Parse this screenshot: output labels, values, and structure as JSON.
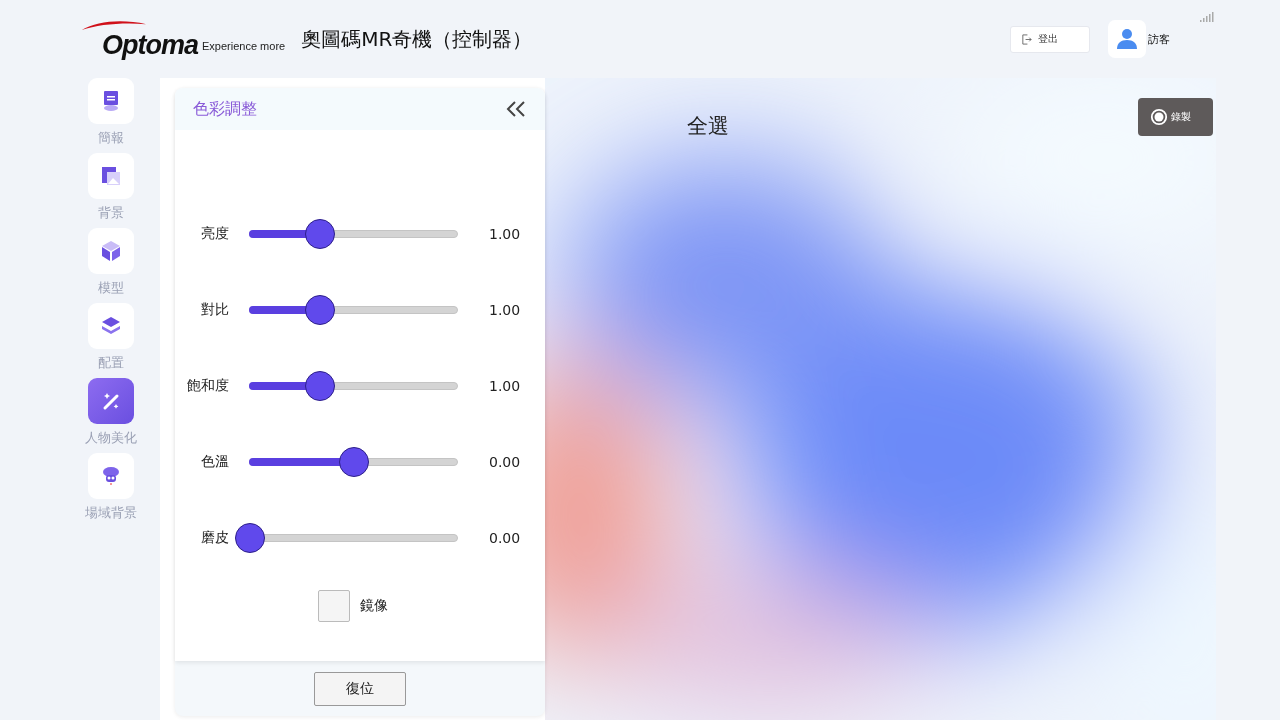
{
  "header": {
    "logo": "Optoma",
    "tagline": "Experience more",
    "title": "奧圖碼MR奇機（控制器）",
    "logout_button": "登出",
    "user": "訪客"
  },
  "sidebar": {
    "items": [
      {
        "label": "簡報",
        "selected": false
      },
      {
        "label": "背景",
        "selected": false
      },
      {
        "label": "模型",
        "selected": false
      },
      {
        "label": "配置",
        "selected": false
      },
      {
        "label": "人物美化",
        "selected": true
      },
      {
        "label": "場域背景",
        "selected": false
      }
    ]
  },
  "panel": {
    "title": "色彩調整",
    "sliders": [
      {
        "label": "亮度",
        "level": 0.34,
        "reading": "1.00"
      },
      {
        "label": "對比",
        "level": 0.34,
        "reading": "1.00"
      },
      {
        "label": "飽和度",
        "level": 0.34,
        "reading": "1.00"
      },
      {
        "label": "色溫",
        "level": 0.5,
        "reading": "0.00"
      },
      {
        "label": "磨皮",
        "level": 0,
        "reading": "0.00"
      }
    ],
    "mirror": {
      "label": "鏡像",
      "checked": false
    },
    "reset_button": "復位"
  },
  "preview": {
    "kind": "picture",
    "select_all": "全選",
    "record_button": "錄製"
  }
}
